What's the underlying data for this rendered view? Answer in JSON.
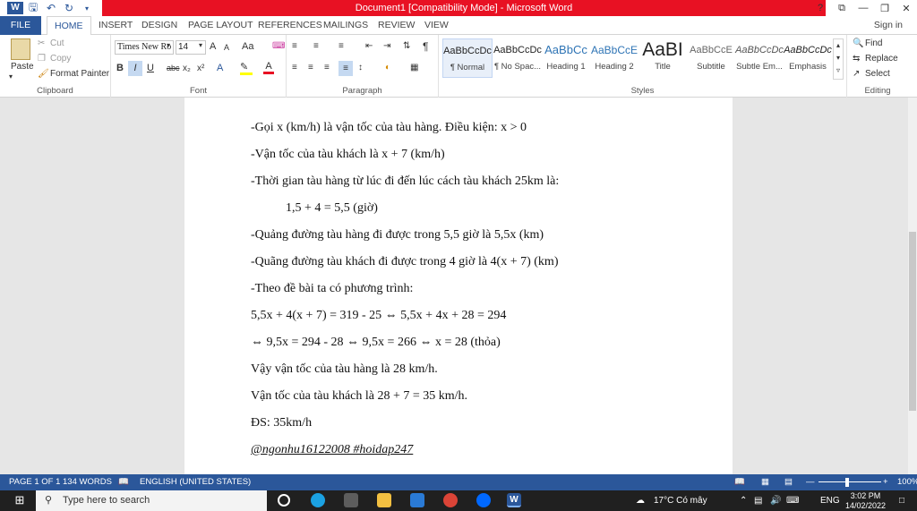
{
  "window": {
    "title": "Document1 [Compatibility Mode] - Microsoft Word"
  },
  "qat": {
    "save_icon": "save-icon",
    "undo_icon": "undo-icon",
    "redo_icon": "redo-icon"
  },
  "window_controls": {
    "help": "?",
    "ribbon_display": "⧉",
    "minimize": "—",
    "restore": "❐",
    "close": "✕"
  },
  "tabs": [
    {
      "label": "FILE"
    },
    {
      "label": "HOME"
    },
    {
      "label": "INSERT"
    },
    {
      "label": "DESIGN"
    },
    {
      "label": "PAGE LAYOUT"
    },
    {
      "label": "REFERENCES"
    },
    {
      "label": "MAILINGS"
    },
    {
      "label": "REVIEW"
    },
    {
      "label": "VIEW"
    }
  ],
  "signin": "Sign in",
  "clipboard": {
    "paste": "Paste",
    "cut": "Cut",
    "copy": "Copy",
    "format_painter": "Format Painter",
    "label": "Clipboard"
  },
  "font": {
    "family": "Times New Ro",
    "size": "14",
    "grow": "A",
    "shrink": "A",
    "case": "Aa",
    "bold": "B",
    "italic": "I",
    "underline": "U",
    "strike": "abc",
    "subscript": "x₂",
    "superscript": "x²",
    "label": "Font"
  },
  "paragraph": {
    "label": "Paragraph"
  },
  "styles": {
    "label": "Styles",
    "items": [
      {
        "sample": "AaBbCcDc",
        "name": "¶ Normal"
      },
      {
        "sample": "AaBbCcDc",
        "name": "¶ No Spac..."
      },
      {
        "sample": "AaBbCc",
        "name": "Heading 1"
      },
      {
        "sample": "AaBbCcE",
        "name": "Heading 2"
      },
      {
        "sample": "AaBI",
        "name": "Title"
      },
      {
        "sample": "AaBbCcE",
        "name": "Subtitle"
      },
      {
        "sample": "AaBbCcDc",
        "name": "Subtle Em..."
      },
      {
        "sample": "AaBbCcDc",
        "name": "Emphasis"
      }
    ]
  },
  "editing": {
    "find": "Find",
    "replace": "Replace",
    "select": "Select",
    "label": "Editing"
  },
  "document": {
    "lines": [
      "-Gọi x (km/h) là vận tốc của tàu hàng. Điều kiện: x > 0",
      "-Vận tốc của tàu khách là x + 7 (km/h)",
      "-Thời gian tàu hàng từ lúc đi đến lúc cách tàu khách 25km là:",
      "1,5 + 4 = 5,5 (giờ)",
      "-Quảng đường tàu hàng đi được trong 5,5 giờ là 5,5x (km)",
      "-Quãng đường tàu khách đi được trong 4 giờ là 4(x + 7) (km)",
      "-Theo đề bài ta có phương trình:",
      "5,5x + 4(x + 7) = 319 - 25 ⇔ 5,5x + 4x + 28 = 294",
      "⇔ 9,5x = 294 - 28 ⇔ 9,5x = 266 ⇔ x = 28 (thỏa)",
      "Vậy vận tốc của tàu hàng là 28 km/h.",
      "Vận tốc của tàu khách là 28 + 7 = 35 km/h.",
      "ĐS: 35km/h",
      "@ngonhu16122008  #hoidap247"
    ]
  },
  "status": {
    "page": "PAGE 1 OF 1",
    "words": "134 WORDS",
    "language": "ENGLISH (UNITED STATES)",
    "zoom": "100%"
  },
  "taskbar": {
    "search_placeholder": "Type here to search",
    "weather": "17°C  Có mây",
    "lang": "ENG",
    "time": "3:02 PM",
    "date": "14/02/2022"
  }
}
